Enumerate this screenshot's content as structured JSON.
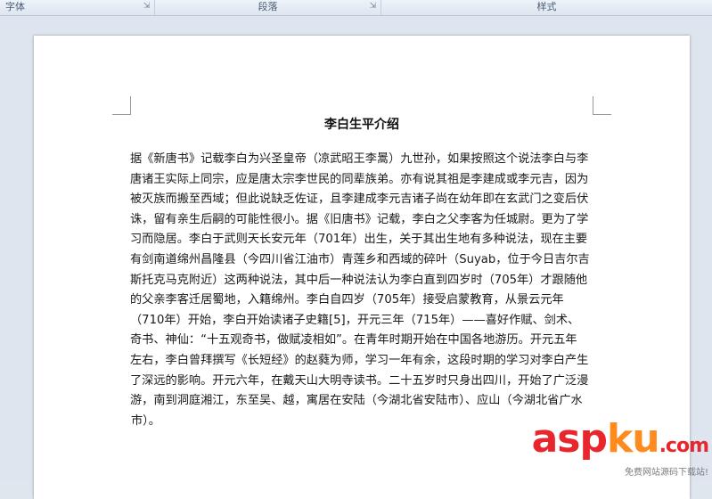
{
  "ribbon": {
    "groups": [
      {
        "label": "字体"
      },
      {
        "label": "段落"
      },
      {
        "label": "样式"
      }
    ]
  },
  "document": {
    "title": "李白生平介绍",
    "lines": [
      "据《新唐书》记载李白为兴圣皇帝（凉武昭王李暠）九世孙，如果按照这个说法李白与李",
      "唐诸王实际上同宗，应是唐太宗李世民的同辈族弟。亦有说其祖是李建成或李元吉，因为",
      "被灭族而搬至西域；但此说缺乏佐证，且李建成李元吉诸子尚在幼年即在玄武门之变后伏",
      "诛，留有亲生后嗣的可能性很小。据《旧唐书》记载，李白之父李客为任城尉。更为了学",
      "习而隐居。李白于武则天长安元年（701年）出生，关于其出生地有多种说法，现在主要",
      "有剑南道绵州昌隆县（今四川省江油市）青莲乡和西域的碎叶（Suyab，位于今日吉尔吉",
      "斯托克马克附近）这两种说法，其中后一种说法认为李白直到四岁时（705年）才跟随他",
      "的父亲李客迁居蜀地，入籍绵州。李白自四岁（705年）接受启蒙教育，从景云元年",
      "（710年）开始，李白开始读诸子史籍[5]，开元三年（715年）——喜好作赋、剑术、",
      "奇书、神仙：“十五观奇书，做赋凌相如”。在青年时期开始在中国各地游历。开元五年",
      "左右，李白曾拜撰写《长短经》的赵蕤为师，学习一年有余，这段时期的学习对李白产生",
      "了深远的影响。开元六年，在戴天山大明寺读书。二十五岁时只身出四川，开始了广泛漫",
      "游，南到洞庭湘江，东至吴、越，寓居在安陆（今湖北省安陆市）、应山（今湖北省广水",
      "市）。"
    ]
  },
  "watermark": {
    "logo_part1": "asp",
    "logo_part2": "ku",
    "logo_part3": ".com",
    "subtitle": "免费网站源码下载站!"
  }
}
